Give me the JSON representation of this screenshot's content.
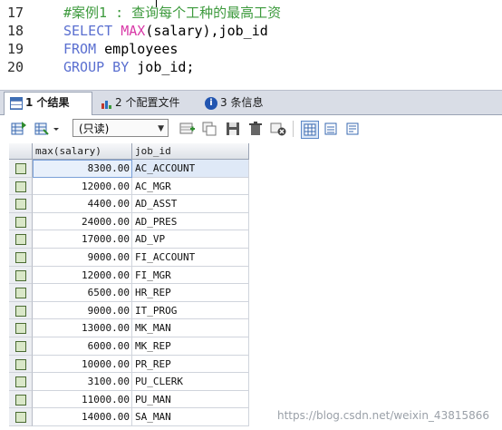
{
  "editor": {
    "lines": [
      {
        "num": "17",
        "parts": [
          {
            "t": "#案例1 : 查询每个工种的最高工资",
            "c": "cm"
          }
        ]
      },
      {
        "num": "18",
        "parts": [
          {
            "t": "SELECT ",
            "c": "kw"
          },
          {
            "t": "MAX",
            "c": "fn"
          },
          {
            "t": "(salary),job_id",
            "c": ""
          }
        ]
      },
      {
        "num": "19",
        "parts": [
          {
            "t": "FROM ",
            "c": "kw"
          },
          {
            "t": "employees",
            "c": ""
          }
        ]
      },
      {
        "num": "20",
        "parts": [
          {
            "t": "GROUP BY ",
            "c": "kw"
          },
          {
            "t": "job_id;",
            "c": ""
          }
        ]
      }
    ]
  },
  "tabs": {
    "result": "1 个结果",
    "profile": "2 个配置文件",
    "messages": "3 条信息"
  },
  "toolbar": {
    "mode_select": "(只读)"
  },
  "grid": {
    "columns": [
      "max(salary)",
      "job_id"
    ],
    "rows": [
      [
        "8300.00",
        "AC_ACCOUNT"
      ],
      [
        "12000.00",
        "AC_MGR"
      ],
      [
        "4400.00",
        "AD_ASST"
      ],
      [
        "24000.00",
        "AD_PRES"
      ],
      [
        "17000.00",
        "AD_VP"
      ],
      [
        "9000.00",
        "FI_ACCOUNT"
      ],
      [
        "12000.00",
        "FI_MGR"
      ],
      [
        "6500.00",
        "HR_REP"
      ],
      [
        "9000.00",
        "IT_PROG"
      ],
      [
        "13000.00",
        "MK_MAN"
      ],
      [
        "6000.00",
        "MK_REP"
      ],
      [
        "10000.00",
        "PR_REP"
      ],
      [
        "3100.00",
        "PU_CLERK"
      ],
      [
        "11000.00",
        "PU_MAN"
      ],
      [
        "14000.00",
        "SA_MAN"
      ]
    ]
  },
  "watermark": "https://blog.csdn.net/weixin_43815866"
}
